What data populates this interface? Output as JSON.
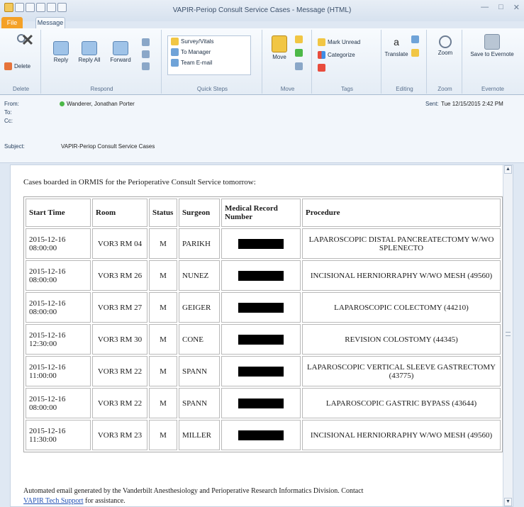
{
  "window": {
    "title": "VAPIR-Periop Consult Service Cases - Message (HTML)",
    "keytip_file": "F",
    "keytip_message": "H"
  },
  "tabs": {
    "file": "File",
    "message": "Message"
  },
  "ribbon": {
    "delete_group": {
      "label": "Delete",
      "delete": "Delete"
    },
    "respond_group": {
      "label": "Respond",
      "reply": "Reply",
      "reply_all": "Reply All",
      "forward": "Forward"
    },
    "quick_steps": {
      "label": "Quick Steps",
      "items": [
        "Survey/Vitals",
        "To Manager",
        "Team E-mail"
      ]
    },
    "move_group": {
      "label": "Move",
      "move": "Move"
    },
    "tags_group": {
      "label": "Tags",
      "mark_unread": "Mark Unread",
      "categorize": "Categorize"
    },
    "editing_group": {
      "label": "Editing",
      "translate": "Translate"
    },
    "zoom_group": {
      "label": "Zoom",
      "zoom": "Zoom"
    },
    "evernote_group": {
      "label": "Evernote",
      "save": "Save to Evernote"
    }
  },
  "header": {
    "from_label": "From:",
    "from_value": "Wanderer, Jonathan Porter",
    "to_label": "To:",
    "cc_label": "Cc:",
    "subject_label": "Subject:",
    "subject_value": "VAPIR-Periop Consult Service Cases",
    "sent_label": "Sent:",
    "sent_value": "Tue 12/15/2015 2:42 PM"
  },
  "message": {
    "intro": "Cases boarded in ORMIS for the Perioperative Consult Service tomorrow:",
    "columns": [
      "Start Time",
      "Room",
      "Status",
      "Surgeon",
      "Medical Record Number",
      "Procedure"
    ],
    "rows": [
      {
        "start": "2015-12-16 08:00:00",
        "room": "VOR3 RM 04",
        "status": "M",
        "surgeon": "PARIKH",
        "procedure": "LAPAROSCOPIC DISTAL PANCREATECTOMY W/WO SPLENECTO"
      },
      {
        "start": "2015-12-16 08:00:00",
        "room": "VOR3 RM 26",
        "status": "M",
        "surgeon": "NUNEZ",
        "procedure": "INCISIONAL HERNIORRAPHY W/WO MESH (49560)"
      },
      {
        "start": "2015-12-16 08:00:00",
        "room": "VOR3 RM 27",
        "status": "M",
        "surgeon": "GEIGER",
        "procedure": "LAPAROSCOPIC COLECTOMY (44210)"
      },
      {
        "start": "2015-12-16 12:30:00",
        "room": "VOR3 RM 30",
        "status": "M",
        "surgeon": "CONE",
        "procedure": "REVISION COLOSTOMY (44345)"
      },
      {
        "start": "2015-12-16 11:00:00",
        "room": "VOR3 RM 22",
        "status": "M",
        "surgeon": "SPANN",
        "procedure": "LAPAROSCOPIC VERTICAL SLEEVE GASTRECTOMY (43775)"
      },
      {
        "start": "2015-12-16 08:00:00",
        "room": "VOR3 RM 22",
        "status": "M",
        "surgeon": "SPANN",
        "procedure": "LAPAROSCOPIC GASTRIC BYPASS (43644)"
      },
      {
        "start": "2015-12-16 11:30:00",
        "room": "VOR3 RM 23",
        "status": "M",
        "surgeon": "MILLER",
        "procedure": "INCISIONAL HERNIORRAPHY W/WO MESH (49560)"
      }
    ],
    "footer_text": "Automated email generated by the Vanderbilt Anesthesiology and Perioperative Research Informatics Division. Contact",
    "footer_link": "VAPIR Tech Support",
    "footer_tail": "for assistance."
  },
  "colors": {
    "file_tab": "#f4a127",
    "link": "#1f4fb4",
    "presence": "#4cb848",
    "redaction": "#000000"
  }
}
